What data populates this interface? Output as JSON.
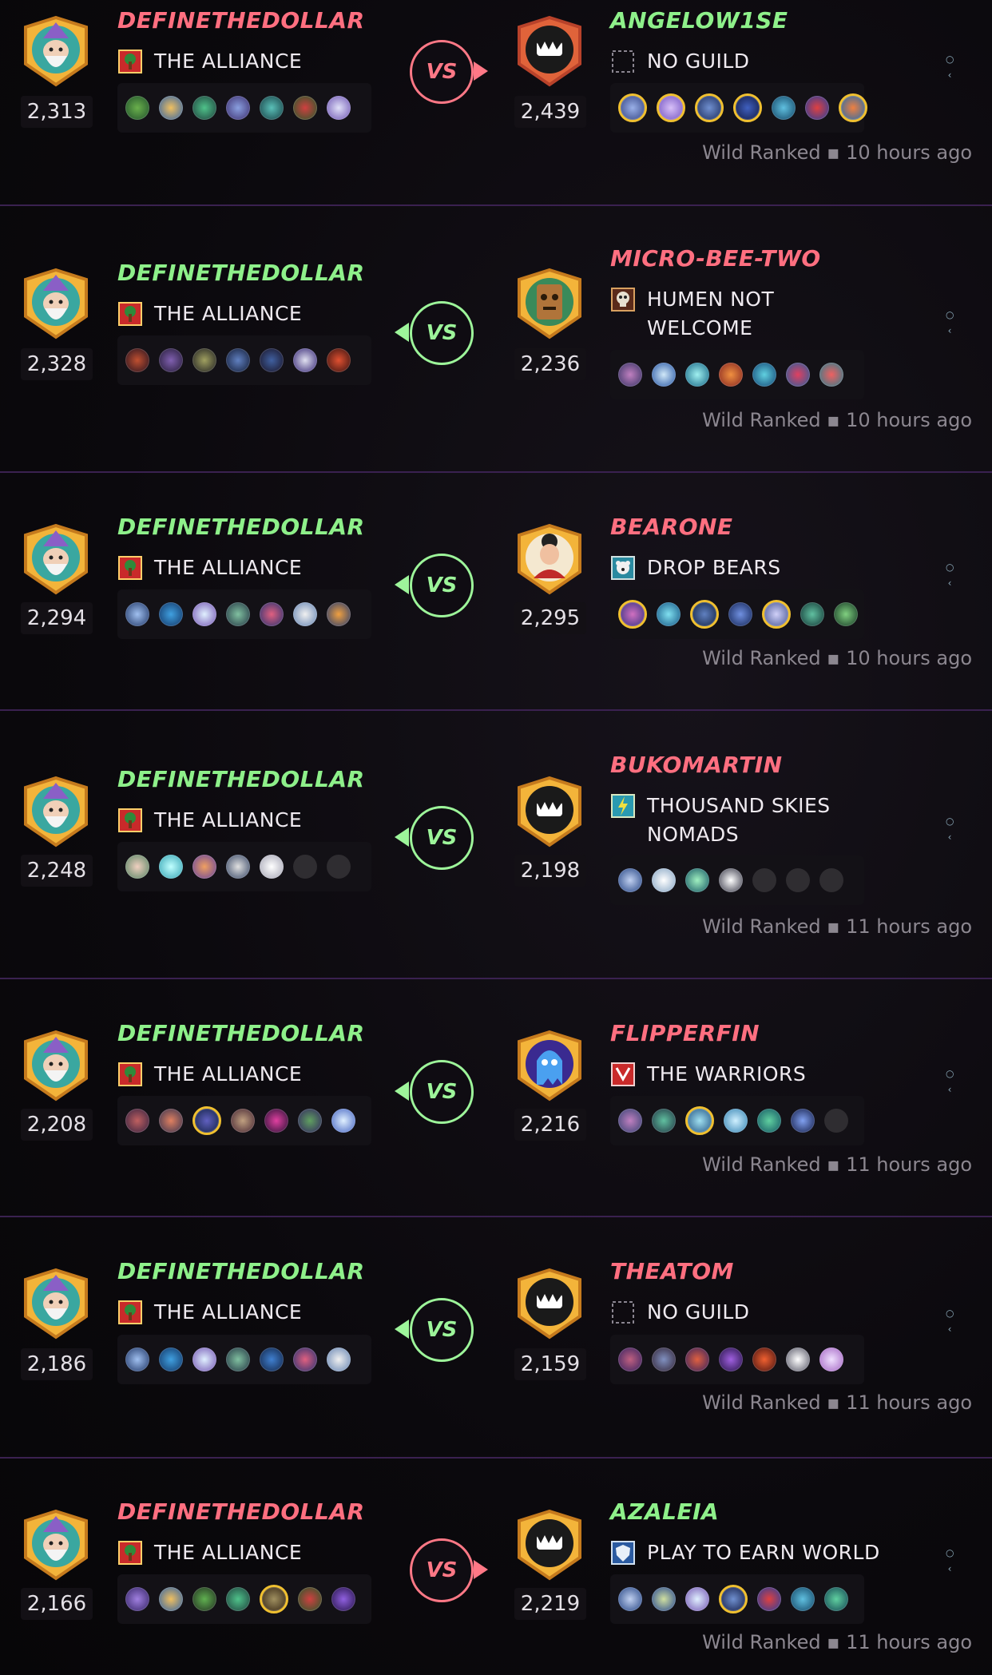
{
  "colors": {
    "win": "#8ef08a",
    "loss": "#ff6f80",
    "vs_win": "#9df59a",
    "vs_loss": "#ff7886",
    "divider": "#3a2150"
  },
  "battles": [
    {
      "left": {
        "name": "DEFINETHEDOLLAR",
        "result": "loss",
        "guild": "THE ALLIANCE",
        "guild_icon": "red-tree-banner-icon",
        "rating": "2,313",
        "avatar": "wizard-avatar-icon"
      },
      "right": {
        "name": "ANGELOW1SE",
        "result": "win",
        "guild": "NO GUILD",
        "guild_icon": "empty-banner-icon",
        "rating": "2,439",
        "avatar": "monster-teeth-avatar-red-icon"
      },
      "vs": "VS",
      "vs_result": "loss",
      "meta": "Wild Ranked ▪ 10 hours ago"
    },
    {
      "left": {
        "name": "DEFINETHEDOLLAR",
        "result": "win",
        "guild": "THE ALLIANCE",
        "guild_icon": "red-tree-banner-icon",
        "rating": "2,328",
        "avatar": "wizard-avatar-icon"
      },
      "right": {
        "name": "MICRO-BEE-TWO",
        "result": "loss",
        "guild": "HUMEN NOT WELCOME",
        "guild_icon": "skull-banner-icon",
        "rating": "2,236",
        "avatar": "tree-golem-avatar-icon"
      },
      "vs": "VS",
      "vs_result": "win",
      "meta": "Wild Ranked ▪ 10 hours ago"
    },
    {
      "left": {
        "name": "DEFINETHEDOLLAR",
        "result": "win",
        "guild": "THE ALLIANCE",
        "guild_icon": "red-tree-banner-icon",
        "rating": "2,294",
        "avatar": "wizard-avatar-icon"
      },
      "right": {
        "name": "BEARONE",
        "result": "loss",
        "guild": "DROP BEARS",
        "guild_icon": "bear-banner-icon",
        "rating": "2,295",
        "avatar": "woman-avatar-icon"
      },
      "vs": "VS",
      "vs_result": "win",
      "meta": "Wild Ranked ▪ 10 hours ago"
    },
    {
      "left": {
        "name": "DEFINETHEDOLLAR",
        "result": "win",
        "guild": "THE ALLIANCE",
        "guild_icon": "red-tree-banner-icon",
        "rating": "2,248",
        "avatar": "wizard-avatar-icon"
      },
      "right": {
        "name": "BUKOMARTIN",
        "result": "loss",
        "guild": "THOUSAND SKIES NOMADS",
        "guild_icon": "lightning-banner-icon",
        "rating": "2,198",
        "avatar": "monster-teeth-avatar-icon"
      },
      "vs": "VS",
      "vs_result": "win",
      "meta": "Wild Ranked ▪ 11 hours ago"
    },
    {
      "left": {
        "name": "DEFINETHEDOLLAR",
        "result": "win",
        "guild": "THE ALLIANCE",
        "guild_icon": "red-tree-banner-icon",
        "rating": "2,208",
        "avatar": "wizard-avatar-icon"
      },
      "right": {
        "name": "FLIPPERFIN",
        "result": "loss",
        "guild": "THE WARRIORS",
        "guild_icon": "warrior-banner-icon",
        "rating": "2,216",
        "avatar": "ghost-avatar-icon"
      },
      "vs": "VS",
      "vs_result": "win",
      "meta": "Wild Ranked ▪ 11 hours ago"
    },
    {
      "left": {
        "name": "DEFINETHEDOLLAR",
        "result": "win",
        "guild": "THE ALLIANCE",
        "guild_icon": "red-tree-banner-icon",
        "rating": "2,186",
        "avatar": "wizard-avatar-icon"
      },
      "right": {
        "name": "THEATOM",
        "result": "loss",
        "guild": "NO GUILD",
        "guild_icon": "empty-banner-icon",
        "rating": "2,159",
        "avatar": "monster-teeth-avatar-icon"
      },
      "vs": "VS",
      "vs_result": "win",
      "meta": "Wild Ranked ▪ 11 hours ago"
    },
    {
      "left": {
        "name": "DEFINETHEDOLLAR",
        "result": "loss",
        "guild": "THE ALLIANCE",
        "guild_icon": "red-tree-banner-icon",
        "rating": "2,166",
        "avatar": "wizard-avatar-icon"
      },
      "right": {
        "name": "AZALEIA",
        "result": "win",
        "guild": "PLAY TO EARN WORLD",
        "guild_icon": "shield-banner-icon",
        "rating": "2,219",
        "avatar": "monster-teeth-avatar-icon"
      },
      "vs": "VS",
      "vs_result": "loss",
      "meta": "Wild Ranked ▪ 11 hours ago"
    }
  ]
}
